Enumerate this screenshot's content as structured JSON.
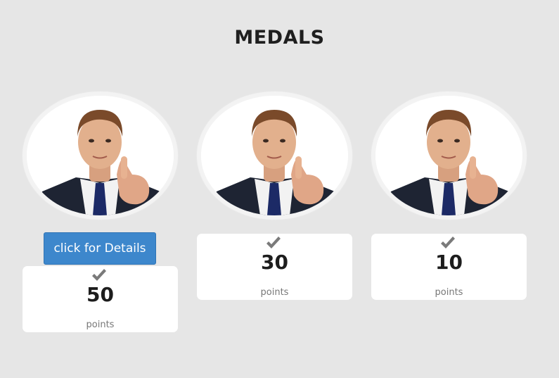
{
  "page": {
    "title": "MEDALS"
  },
  "medals": [
    {
      "button_label": "click for Details",
      "points": "50",
      "unit": "points"
    },
    {
      "points": "30",
      "unit": "points"
    },
    {
      "points": "10",
      "unit": "points"
    }
  ],
  "icons": {
    "check": "check-icon"
  },
  "colors": {
    "background": "#e6e6e6",
    "button": "#3d87cc",
    "check": "#7a7a7a",
    "card": "#ffffff"
  }
}
